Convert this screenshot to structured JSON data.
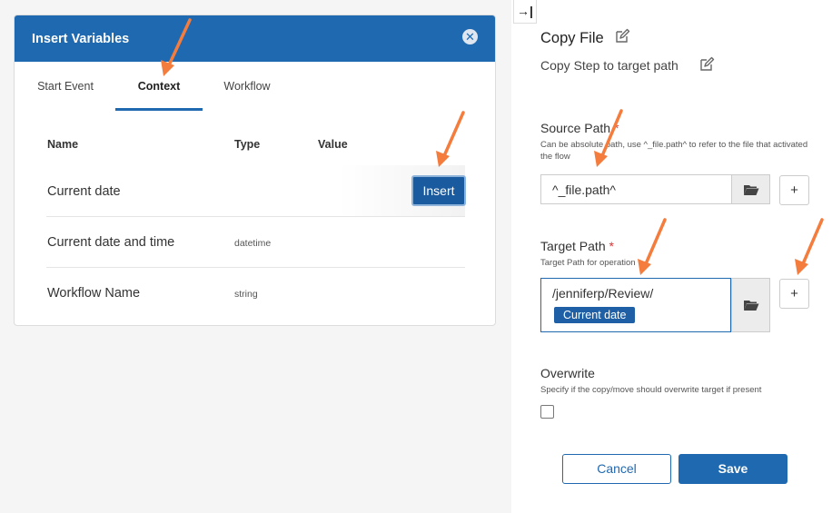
{
  "modal": {
    "title": "Insert Variables",
    "close_glyph": "✕",
    "tabs": [
      {
        "label": "Start Event"
      },
      {
        "label": "Context"
      },
      {
        "label": "Workflow"
      }
    ],
    "active_tab": "Context",
    "columns": {
      "name": "Name",
      "type": "Type",
      "value": "Value"
    },
    "rows": [
      {
        "name": "Current date",
        "type": ""
      },
      {
        "name": "Current date and time",
        "type": "datetime"
      },
      {
        "name": "Workflow Name",
        "type": "string"
      }
    ],
    "insert_label": "Insert"
  },
  "panel": {
    "collapse_glyph": "→|",
    "title": "Copy File",
    "subtitle": "Copy Step to target path",
    "source": {
      "label": "Source Path",
      "required_mark": "*",
      "help": "Can be absolute path, use ^_file.path^ to refer to the file that activated the flow",
      "value": "^_file.path^",
      "plus": "+"
    },
    "target": {
      "label": "Target Path",
      "required_mark": "*",
      "help": "Target Path for operation",
      "value": "/jenniferp/Review/",
      "chip": "Current date",
      "plus": "+"
    },
    "overwrite": {
      "label": "Overwrite",
      "help": "Specify if the copy/move should overwrite target if present",
      "checked": false
    },
    "cancel_label": "Cancel",
    "save_label": "Save"
  },
  "icons": [
    "close-icon",
    "edit-icon",
    "folder-icon",
    "plus-icon",
    "collapse-panel-icon",
    "arrow-annotation-icon"
  ],
  "colors": {
    "primary": "#1f69b1",
    "insert_button": "#1a5a9e",
    "arrow": "#f47c3c",
    "required": "#d33333"
  }
}
